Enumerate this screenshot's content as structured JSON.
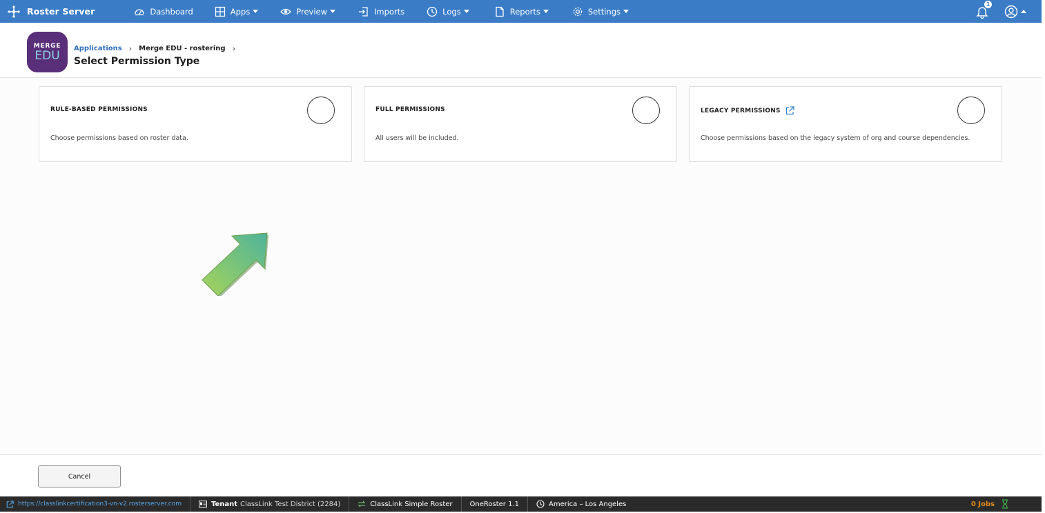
{
  "topnav": {
    "brand": "Roster Server",
    "items": [
      {
        "label": "Dashboard",
        "icon": "dashboard-icon",
        "dropdown": false
      },
      {
        "label": "Apps",
        "icon": "apps-grid-icon",
        "dropdown": true
      },
      {
        "label": "Preview",
        "icon": "eye-icon",
        "dropdown": true
      },
      {
        "label": "Imports",
        "icon": "import-icon",
        "dropdown": false
      },
      {
        "label": "Logs",
        "icon": "clock-icon",
        "dropdown": true
      },
      {
        "label": "Reports",
        "icon": "document-icon",
        "dropdown": true
      },
      {
        "label": "Settings",
        "icon": "gear-icon",
        "dropdown": true
      }
    ],
    "notification_count": "1",
    "accent_color": "#3a7cc6"
  },
  "header": {
    "logo_top": "MERGE",
    "logo_bottom": "EDU",
    "breadcrumb": {
      "root": "Applications",
      "current": "Merge EDU - rostering"
    },
    "title": "Select Permission Type"
  },
  "cards": [
    {
      "title": "RULE-BASED PERMISSIONS",
      "description": "Choose permissions based on roster data.",
      "selected": false
    },
    {
      "title": "FULL PERMISSIONS",
      "description": "All users will be included.",
      "selected": false
    },
    {
      "title": "LEGACY PERMISSIONS",
      "description": "Choose permissions based on the legacy system of org and course dependencies.",
      "selected": false,
      "external_link_icon": "external-link-icon"
    }
  ],
  "footer": {
    "cancel_label": "Cancel"
  },
  "statusbar": {
    "url": "https://classlinkcertification3-vn-v2.rosterserver.com",
    "tenant_key": "Tenant",
    "tenant_value": "ClassLink Test District (2284)",
    "roster": "ClassLink Simple Roster",
    "oneroster": "OneRoster 1.1",
    "timezone": "America – Los Angeles",
    "jobs": "0 Jobs"
  }
}
